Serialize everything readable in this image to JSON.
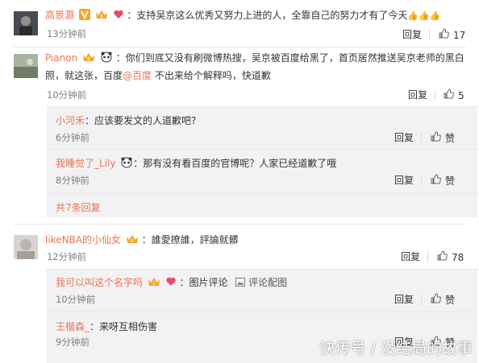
{
  "comments": [
    {
      "user": "高景灏",
      "text": "：支持吴京这么优秀又努力上进的人，全靠自己的努力才有了今天",
      "emoji": "👍👍👍",
      "time": "13分钟前",
      "reply": "回复",
      "likes": "17"
    },
    {
      "user": "Pianon",
      "text_line1": "：你们到底又没有刷微博热搜，吴京被百度给黑了，首页居然推送吴京老师的黑白",
      "text_line2_a": "照，就这张，百度",
      "mention": "@百度",
      "text_line2_b": " 不出来给个解释吗，快道歉",
      "time": "10分钟前",
      "reply": "回复",
      "likes": "5",
      "sub_replies": [
        {
          "user": "小河禾",
          "text": "：应该要发文的人道歉吧?",
          "time": "6分钟前",
          "reply": "回复",
          "like": "赞"
        },
        {
          "user": "我睡觉了_Lily",
          "text": "：那有没有看百度的官博呢？人家已经道歉了哦",
          "time": "8分钟前",
          "reply": "回复",
          "like": "赞"
        }
      ],
      "more": "共7条回复"
    },
    {
      "user": "likeNBA的小仙女",
      "text": "：誰愛撩誰，評論就髒",
      "time": "12分钟前",
      "reply": "回复",
      "likes": "78",
      "sub_replies": [
        {
          "user": "我可以叫这个名字吗",
          "text": "：图片评论",
          "pic_label": "评论配图",
          "time": "10分钟前",
          "reply": "回复",
          "like": "赞"
        },
        {
          "user": "王楷森_",
          "text": "：来呀互相伤害",
          "time": "9分钟前",
          "reply": "回复",
          "like": "赞"
        }
      ]
    }
  ],
  "watermark": "快传号 / 没结局的故事",
  "colors": {
    "accent": "#eb7350",
    "reply_bg": "#f2f2f5"
  }
}
